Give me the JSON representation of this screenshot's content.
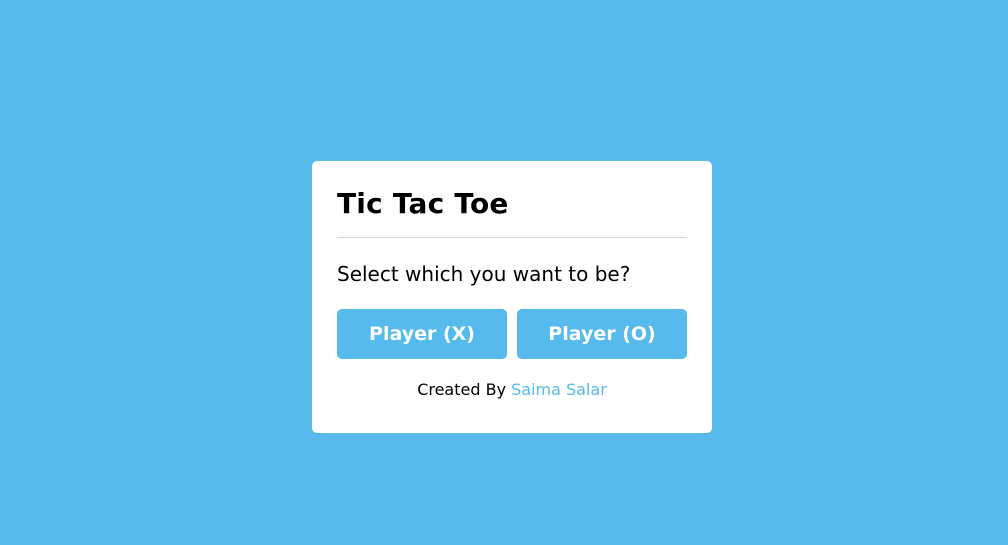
{
  "colors": {
    "background": "#56baed",
    "card": "#ffffff",
    "accent": "#56baed",
    "text": "#000000"
  },
  "card": {
    "title": "Tic Tac Toe",
    "prompt": "Select which you want to be?",
    "buttons": {
      "player_x": "Player (X)",
      "player_o": "Player (O)"
    },
    "footer": {
      "prefix": "Created By ",
      "author": "Saima Salar"
    }
  }
}
